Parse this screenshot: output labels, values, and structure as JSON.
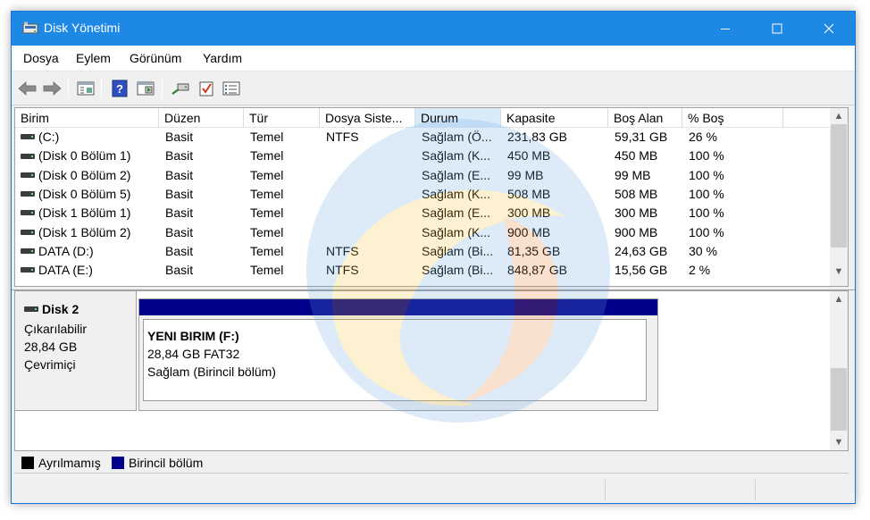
{
  "window": {
    "title": "Disk Yönetimi"
  },
  "menu": [
    "Dosya",
    "Eylem",
    "Görünüm",
    "Yardım"
  ],
  "columns": [
    "Birim",
    "Düzen",
    "Tür",
    "Dosya Siste...",
    "Durum",
    "Kapasite",
    "Boş Alan",
    "% Boş"
  ],
  "volumes": [
    {
      "name": "(C:)",
      "layout": "Basit",
      "type": "Temel",
      "fs": "NTFS",
      "status": "Sağlam (Ö...",
      "capacity": "231,83 GB",
      "free": "59,31 GB",
      "pct": "26 %"
    },
    {
      "name": "(Disk 0 Bölüm 1)",
      "layout": "Basit",
      "type": "Temel",
      "fs": "",
      "status": "Sağlam (K...",
      "capacity": "450 MB",
      "free": "450 MB",
      "pct": "100 %"
    },
    {
      "name": "(Disk 0 Bölüm 2)",
      "layout": "Basit",
      "type": "Temel",
      "fs": "",
      "status": "Sağlam (E...",
      "capacity": "99 MB",
      "free": "99 MB",
      "pct": "100 %"
    },
    {
      "name": "(Disk 0 Bölüm 5)",
      "layout": "Basit",
      "type": "Temel",
      "fs": "",
      "status": "Sağlam (K...",
      "capacity": "508 MB",
      "free": "508 MB",
      "pct": "100 %"
    },
    {
      "name": "(Disk 1 Bölüm 1)",
      "layout": "Basit",
      "type": "Temel",
      "fs": "",
      "status": "Sağlam (E...",
      "capacity": "300 MB",
      "free": "300 MB",
      "pct": "100 %"
    },
    {
      "name": "(Disk 1 Bölüm 2)",
      "layout": "Basit",
      "type": "Temel",
      "fs": "",
      "status": "Sağlam (K...",
      "capacity": "900 MB",
      "free": "900 MB",
      "pct": "100 %"
    },
    {
      "name": "DATA (D:)",
      "layout": "Basit",
      "type": "Temel",
      "fs": "NTFS",
      "status": "Sağlam (Bi...",
      "capacity": "81,35 GB",
      "free": "24,63 GB",
      "pct": "30 %"
    },
    {
      "name": "DATA (E:)",
      "layout": "Basit",
      "type": "Temel",
      "fs": "NTFS",
      "status": "Sağlam (Bi...",
      "capacity": "848,87 GB",
      "free": "15,56 GB",
      "pct": "2 %"
    }
  ],
  "disk": {
    "name": "Disk 2",
    "type": "Çıkarılabilir",
    "size": "28,84 GB",
    "state": "Çevrimiçi"
  },
  "partition": {
    "name": "YENI BIRIM  (F:)",
    "size_fs": "28,84 GB FAT32",
    "status": "Sağlam (Birincil bölüm)"
  },
  "legend": [
    {
      "label": "Ayrılmamış",
      "color": "#000000"
    },
    {
      "label": "Birincil bölüm",
      "color": "#00008b"
    }
  ],
  "icons": {
    "titlebar": "disk-management-icon",
    "toolbar": [
      "back-icon",
      "forward-icon",
      "properties-icon",
      "help-icon",
      "view-icon",
      "connect-icon",
      "check-icon",
      "list-icon"
    ]
  },
  "colors": {
    "titlebar": "#1e88e5",
    "primary_partition": "#00008b"
  }
}
